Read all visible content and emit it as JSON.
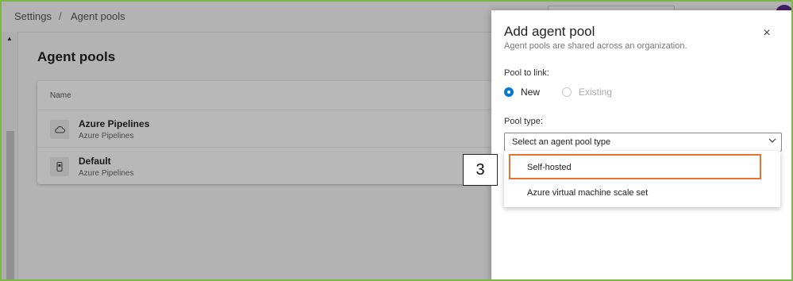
{
  "breadcrumb": {
    "items": [
      "Settings",
      "Agent pools"
    ],
    "separator": "/"
  },
  "page": {
    "title": "Agent pools",
    "table": {
      "column_header": "Name",
      "rows": [
        {
          "name": "Azure Pipelines",
          "subtitle": "Azure Pipelines",
          "icon": "cloud-icon"
        },
        {
          "name": "Default",
          "subtitle": "Azure Pipelines",
          "icon": "agent-device-icon"
        }
      ]
    }
  },
  "panel": {
    "title": "Add agent pool",
    "subtitle": "Agent pools are shared across an organization.",
    "close_icon": "×",
    "pool_to_link_label": "Pool to link:",
    "radio_new": "New",
    "radio_existing": "Existing",
    "selected_radio": "New",
    "pool_type_label": "Pool type:",
    "select_placeholder": "Select an agent pool type",
    "dropdown_options": [
      "Self-hosted",
      "Azure virtual machine scale set"
    ],
    "highlighted_option": "Self-hosted"
  },
  "callout": {
    "number": "3"
  },
  "colors": {
    "accent": "#0078d4",
    "highlight": "#e8722e",
    "frame": "#7ab648",
    "avatar": "#5c2d91"
  }
}
